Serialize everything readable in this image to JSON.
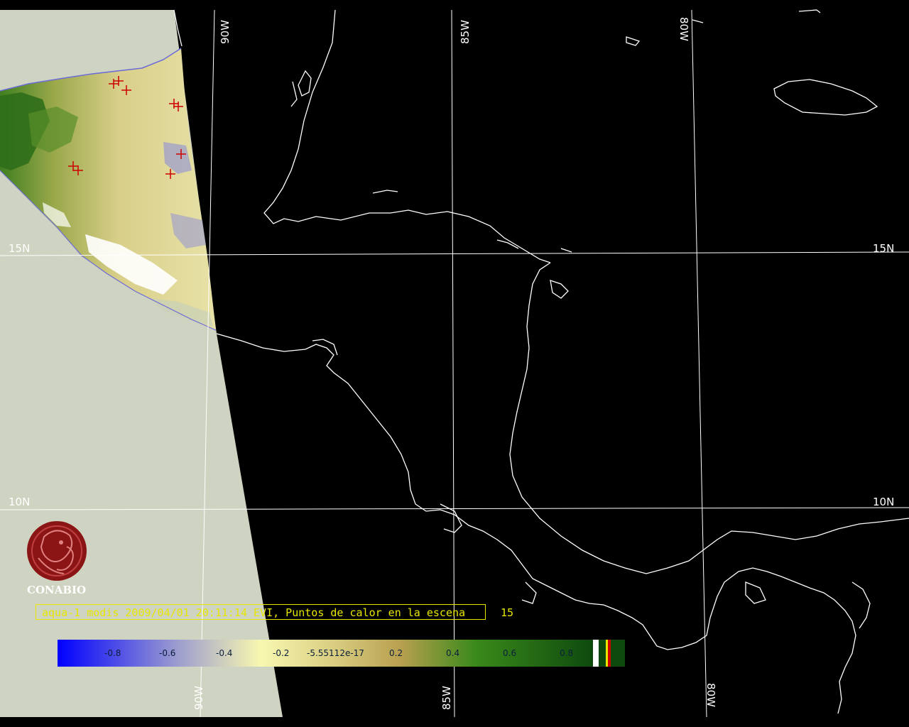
{
  "map": {
    "longitude_labels": [
      "90W",
      "85W",
      "80W"
    ],
    "latitude_labels": [
      "15N",
      "10N"
    ],
    "fire_points_count": 8
  },
  "logo": {
    "name": "CONABIO",
    "icon": "macaw-emblem-icon"
  },
  "caption": {
    "text": "aqua-1 modis 2009/04/01 20:11:14 EVI, Puntos de calor en la escena",
    "count": "15"
  },
  "colorbar": {
    "labels": [
      "-0.8",
      "-0.6",
      "-0.4",
      "-0.2",
      "-5.55112e-17",
      "0.2",
      "0.4",
      "0.6",
      "0.8"
    ],
    "colors": {
      "low": "#0000ff",
      "mid_low": "#9a9ad0",
      "neutral": "#f8f8b0",
      "mid_high": "#b8a050",
      "high": "#2e7d12",
      "max": "#0e4a0e"
    },
    "special_swatches": [
      "white",
      "red",
      "yellow"
    ]
  },
  "colors": {
    "background": "#000000",
    "no_data": "#cfd3c1",
    "coastline": "#ffffff",
    "grid": "#ffffff",
    "fire_marker": "#cc0000",
    "caption": "#e6e600"
  }
}
